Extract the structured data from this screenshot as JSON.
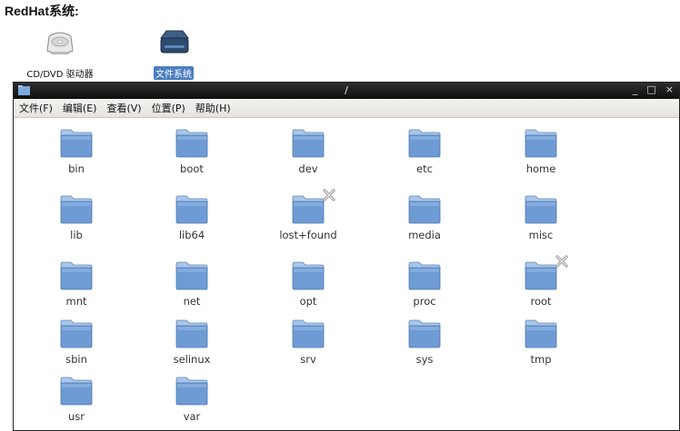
{
  "heading": "RedHat系统:",
  "desktop": {
    "items": [
      {
        "label": "CD/DVD 驱动器",
        "icon": "cd-dvd-drive-icon"
      },
      {
        "label": "文件系统",
        "icon": "filesystem-drive-icon",
        "selected": true
      }
    ]
  },
  "window": {
    "title": "/",
    "controls": {
      "minimize": "_",
      "maximize": "□",
      "close": "×"
    },
    "menu": [
      "文件(F)",
      "编辑(E)",
      "查看(V)",
      "位置(P)",
      "帮助(H)"
    ],
    "folders": [
      {
        "name": "bin"
      },
      {
        "name": "boot"
      },
      {
        "name": "dev"
      },
      {
        "name": "etc"
      },
      {
        "name": "home"
      },
      {
        "name": "lib"
      },
      {
        "name": "lib64"
      },
      {
        "name": "lost+found",
        "locked": true
      },
      {
        "name": "media"
      },
      {
        "name": "misc"
      },
      {
        "name": "mnt"
      },
      {
        "name": "net"
      },
      {
        "name": "opt"
      },
      {
        "name": "proc"
      },
      {
        "name": "root",
        "locked": true
      },
      {
        "name": "sbin"
      },
      {
        "name": "selinux"
      },
      {
        "name": "srv"
      },
      {
        "name": "sys"
      },
      {
        "name": "tmp"
      },
      {
        "name": "usr"
      },
      {
        "name": "var"
      }
    ]
  },
  "colors": {
    "folder": "#6f9bd4",
    "folder_light": "#a9c6ea",
    "selection": "#4a7ebf",
    "titlebar": "#1a1a1a"
  }
}
